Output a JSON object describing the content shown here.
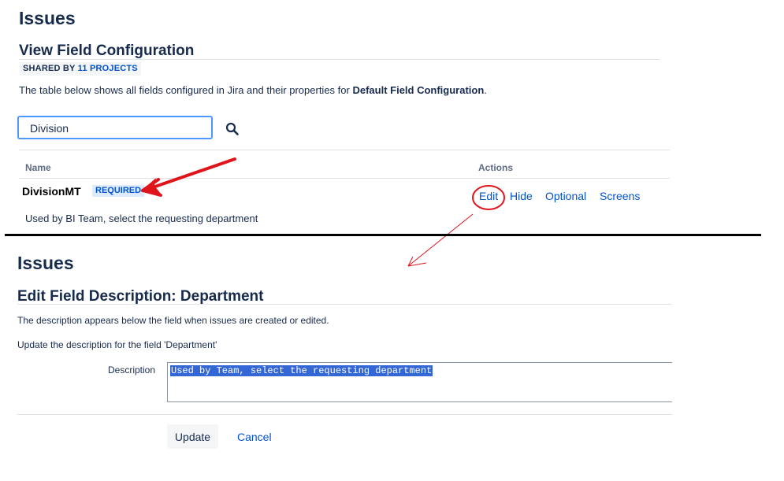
{
  "top": {
    "title": "Issues",
    "subtitle": "View Field Configuration",
    "shared_prefix": "SHARED BY",
    "shared_link": "11 PROJECTS",
    "desc_prefix": "The table below shows all fields configured in Jira and their properties for",
    "desc_bold": "Default Field Configuration",
    "desc_suffix": ".",
    "search": {
      "value": "Division",
      "icon": "search-icon"
    },
    "table": {
      "col_name": "Name",
      "col_actions": "Actions",
      "row": {
        "name": "DivisionMT",
        "badge": "REQUIRED",
        "description": "Used by BI Team, select the requesting department",
        "actions": [
          "Edit",
          "Hide",
          "Optional",
          "Screens"
        ]
      }
    }
  },
  "bottom": {
    "title": "Issues",
    "subtitle": "Edit Field Description: Department",
    "line1": "The description appears below the field when issues are created or edited.",
    "line2": "Update the description for the field 'Department'",
    "desc_label": "Description",
    "desc_value": "Used by Team, select the requesting department",
    "update_label": "Update",
    "cancel_label": "Cancel"
  },
  "annotations": {
    "arrow_color": "#e0141b",
    "circle_color": "#e0141b",
    "divider_color": "#000000"
  }
}
